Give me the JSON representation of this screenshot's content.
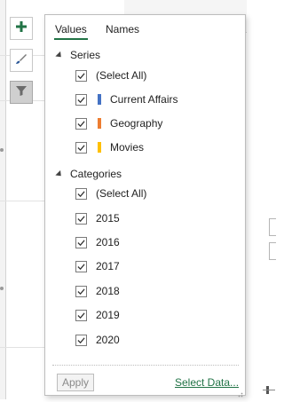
{
  "popup": {
    "tabs": [
      {
        "label": "Values",
        "active": true
      },
      {
        "label": "Names",
        "active": false
      }
    ],
    "series": {
      "header": "Series",
      "items": [
        {
          "label": "(Select All)",
          "checked": true
        },
        {
          "label": "Current Affairs",
          "checked": true,
          "color": "#4472c4"
        },
        {
          "label": "Geography",
          "checked": true,
          "color": "#ed7d31"
        },
        {
          "label": "Movies",
          "checked": true,
          "color": "#ffc000"
        }
      ]
    },
    "categories": {
      "header": "Categories",
      "items": [
        {
          "label": "(Select All)",
          "checked": true
        },
        {
          "label": "2015",
          "checked": true
        },
        {
          "label": "2016",
          "checked": true
        },
        {
          "label": "2017",
          "checked": true
        },
        {
          "label": "2018",
          "checked": true
        },
        {
          "label": "2019",
          "checked": true
        },
        {
          "label": "2020",
          "checked": true
        }
      ]
    },
    "apply_label": "Apply",
    "select_data_label": "Select Data..."
  },
  "side_buttons": [
    {
      "icon": "plus-icon"
    },
    {
      "icon": "paintbrush-icon"
    },
    {
      "icon": "filter-icon",
      "active": true
    }
  ],
  "colors": {
    "accent": "#217346"
  }
}
